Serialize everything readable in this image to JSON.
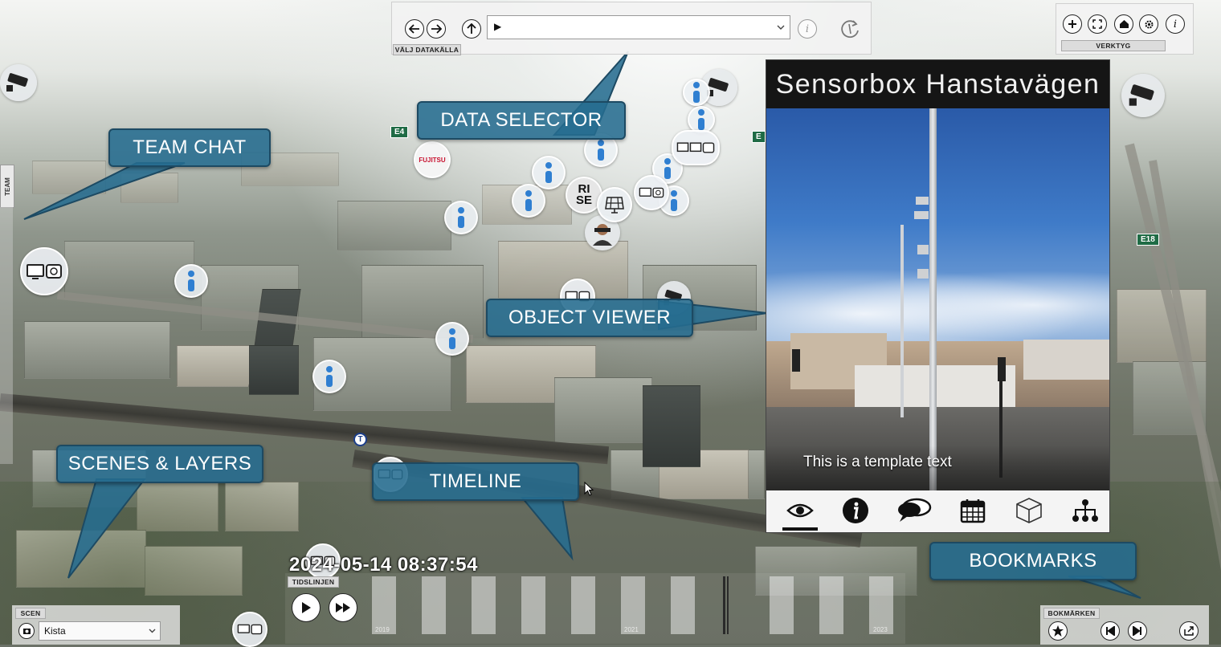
{
  "data_selector": {
    "source_label": "VÄLJ DATAKÄLLA",
    "select_value": "▶"
  },
  "tools": {
    "label": "VERKTYG",
    "buttons": [
      "zoom-in-icon",
      "fullscreen-icon",
      "home-icon",
      "settings-icon",
      "info-icon"
    ]
  },
  "object_viewer": {
    "title": "Sensorbox Hanstavägen",
    "template_text": "This is a template text",
    "tabs": [
      "eye-icon",
      "info-icon",
      "chat-icon",
      "calendar-icon",
      "cube-icon",
      "hierarchy-icon"
    ],
    "active_tab": "eye-icon"
  },
  "callouts": {
    "data_selector": "DATA SELECTOR",
    "team_chat": "TEAM CHAT",
    "object_viewer": "OBJECT VIEWER",
    "scenes_layers": "SCENES & LAYERS",
    "timeline": "TIMELINE",
    "bookmarks": "BOOKMARKS"
  },
  "team_chat": {
    "tab_label": "TEAM"
  },
  "timeline": {
    "datetime": "2024-05-14 08:37:54",
    "label": "TIDSLINJEN",
    "year_ticks": [
      "2019",
      "2021",
      "2023"
    ]
  },
  "scene": {
    "label": "SCEN",
    "selected": "Kista"
  },
  "bookmarks": {
    "label": "BOKMÄRKEN"
  },
  "map_labels": {
    "road_e4": "E4",
    "road_e18": "E18",
    "road_e4_right": "E",
    "fujitsu": "FUJITSU",
    "rise_top": "RI",
    "rise_bottom": "SE",
    "transit": "T"
  },
  "colors": {
    "callout_fill": "#266c8f",
    "info_blue": "#2f7fd1",
    "viewer_header": "#151515"
  }
}
